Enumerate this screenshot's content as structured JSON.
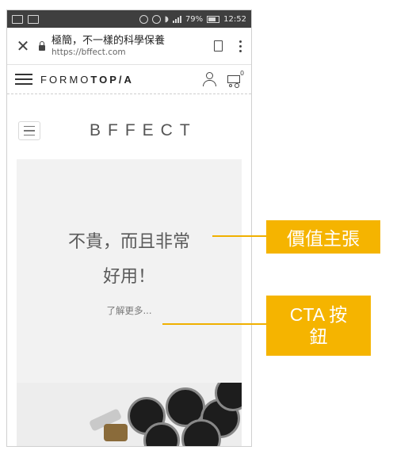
{
  "status_bar": {
    "battery": "79%",
    "time": "12:52"
  },
  "browser": {
    "page_title": "極簡，不一樣的科學保養",
    "url": "https://bffect.com",
    "close_glyph": "✕"
  },
  "site_header": {
    "logo_regular": "FORMO",
    "logo_bold": "TOP",
    "logo_slash": "/",
    "logo_end": "A",
    "cart_count": "0"
  },
  "brand": {
    "name": "BFFECT"
  },
  "hero": {
    "headline_line1": "不貴，而且非常",
    "headline_line2": "好用！",
    "cta_label": "了解更多..."
  },
  "annotations": {
    "value_prop_label": "價值主張",
    "cta_label_line1": "CTA 按",
    "cta_label_line2": "鈕",
    "color": "#f5b400"
  }
}
